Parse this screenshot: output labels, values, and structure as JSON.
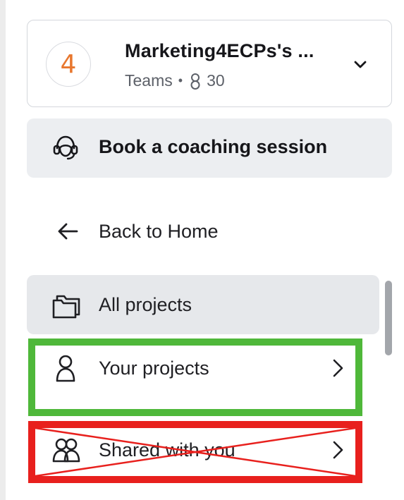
{
  "team": {
    "avatar_text": "4",
    "name": "Marketing4ECPs's ...",
    "type": "Teams",
    "separator": "•",
    "member_count": "30"
  },
  "coaching": {
    "label": "Book a coaching session"
  },
  "back": {
    "label": "Back to Home"
  },
  "nav": {
    "all_projects": "All projects",
    "your_projects": "Your projects",
    "shared_with_you": "Shared with you"
  },
  "annotations": {
    "green_highlight_color": "#4fb83a",
    "red_highlight_color": "#e8201d",
    "avatar_color": "#e8772e"
  },
  "icons": [
    "chevron-down-icon",
    "headset-icon",
    "arrow-left-icon",
    "folder-icon",
    "user-icon",
    "users-icon",
    "chevron-right-icon",
    "members-icon"
  ]
}
